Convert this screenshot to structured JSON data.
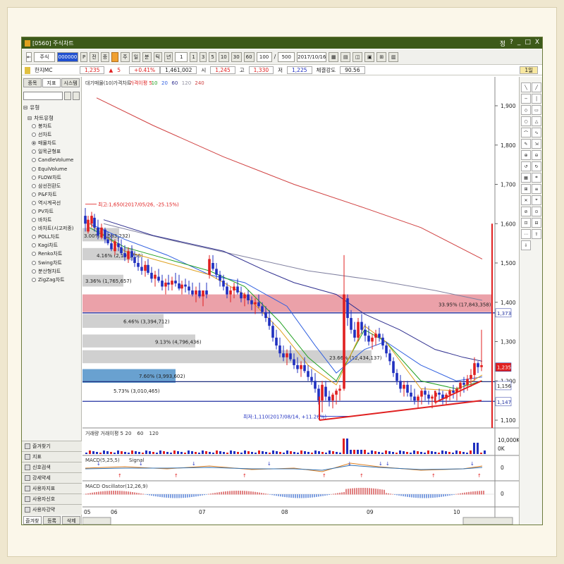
{
  "window": {
    "title": "[0560] 주식차트",
    "title_buttons": [
      "정",
      "?",
      "_",
      "□",
      "X"
    ]
  },
  "toolbar": {
    "market": "주식",
    "code": "000000",
    "buttons": [
      "P",
      "전",
      "종",
      "주",
      "일",
      "분",
      "틱",
      "년",
      "1",
      "1",
      "3",
      "5",
      "10",
      "30",
      "60"
    ],
    "count": "100",
    "total": "500",
    "date": "2017/10/16"
  },
  "quote": {
    "name": "한지MC",
    "price": "1,235",
    "change": "5",
    "pct": "+0.41%",
    "volume": "1,461,002",
    "open_label": "시",
    "open": "1,245",
    "high_label": "고",
    "high": "1,330",
    "low_label": "저",
    "low": "1,225",
    "strength_label": "체결강도",
    "strength": "90.56",
    "right_tag": "1일"
  },
  "left": {
    "tabs": [
      "종목",
      "지표",
      "시스템"
    ],
    "active_tab": 1,
    "tree_header": "유형",
    "tree_group": "차트유형",
    "items": [
      "봉차트",
      "선차트",
      "매물차트",
      "일목균형표",
      "CandleVolume",
      "EquiVolume",
      "FLOW차트",
      "삼선전환도",
      "P&F차트",
      "역시계곡선",
      "PV차트",
      "바차트",
      "바차트(시고저종)",
      "POLL차트",
      "Kagi차트",
      "Renko차트",
      "Swing차트",
      "분산형차트",
      "ZigZag차트"
    ],
    "selected_item": 2,
    "bottom_buttons": [
      "즐겨찾기",
      "지표",
      "신호검색",
      "강세약세",
      "사용자지표",
      "사용자신호",
      "사용자강약"
    ],
    "footer_tabs": [
      "즐겨찾기",
      "등록",
      "삭제"
    ]
  },
  "chart": {
    "legend_main": [
      "대기매물(10)",
      "가격차트",
      "가격이평 5",
      "10",
      "20",
      "60",
      "120",
      "240"
    ],
    "legend_volume": [
      "거래량",
      "거래이평 5",
      "20",
      "60",
      "120"
    ],
    "legend_macd": [
      "MACD(5,25,5)",
      "Signal"
    ],
    "legend_osc": [
      "MACD Oscillator(12,26,9)"
    ],
    "price_ticks": [
      "1,900",
      "1,800",
      "1,700",
      "1,600",
      "1,500",
      "1,400",
      "1,300",
      "1,200",
      "1,100"
    ],
    "price_tags": [
      "1,373",
      "1,235",
      "1,156",
      "1,147"
    ],
    "volume_ticks": [
      "10,000K",
      "0K"
    ],
    "macd_tick": "0",
    "osc_tick": "0",
    "month_labels": [
      "05",
      "06",
      "07",
      "08",
      "09",
      "10"
    ],
    "high_annotation": "최고:1,650(2017/05/26, -25.15%)",
    "low_annotation": "최저:1,110(2017/08/14, +11.26%)",
    "profile_labels": [
      "3.00% (1,583,232)",
      "4.16% (2,197,758)",
      "3.36% (1,765,657)",
      "33.95% (17,843,358)",
      "6.46% (3,394,712)",
      "9.13% (4,796,436)",
      "23.66% (12,434,137)",
      "7.60% (3,993,602)",
      "5.73% (3,010,465)"
    ],
    "right_tools": [
      "가로",
      "세로",
      "대각",
      "지지",
      "추세",
      "피보",
      "갠",
      "원",
      "사각"
    ]
  },
  "colors": {
    "title_bg": "#3d5a1a",
    "up": "#e02020",
    "down": "#2030c0",
    "profile_highlight": "#e8909a",
    "profile_current": "#4f90c8",
    "profile_normal": "#c8c8c8"
  }
}
